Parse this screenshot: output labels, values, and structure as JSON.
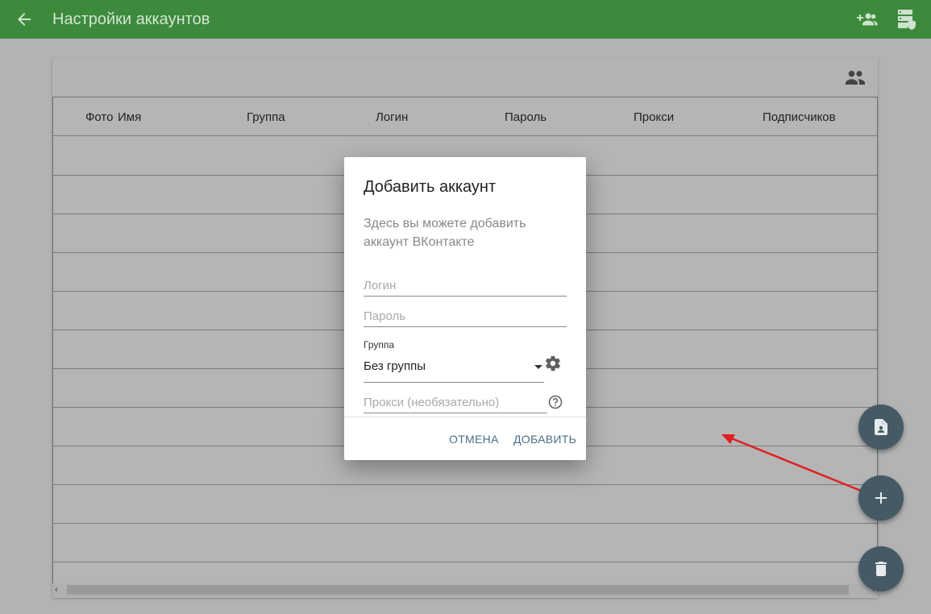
{
  "appbar": {
    "title": "Настройки аккаунтов",
    "color": "#3d8a3d"
  },
  "table": {
    "columns": [
      "Фото",
      "Имя",
      "Группа",
      "Логин",
      "Пароль",
      "Прокси",
      "Подписчиков"
    ],
    "row_count": 11
  },
  "dialog": {
    "title": "Добавить аккаунт",
    "description": "Здесь вы можете добавить аккаунт ВКонтакте",
    "login_placeholder": "Логин",
    "password_placeholder": "Пароль",
    "group_label": "Группа",
    "group_value": "Без группы",
    "proxy_placeholder": "Прокси (необязательно)",
    "cancel_label": "ОТМЕНА",
    "add_label": "ДОБАВИТЬ",
    "button_color": "#4a6f88"
  },
  "fabs": {
    "color": "#455a64",
    "icons": [
      "file-account-icon",
      "plus-icon",
      "trash-icon"
    ]
  },
  "annotation_color": "#e02020"
}
